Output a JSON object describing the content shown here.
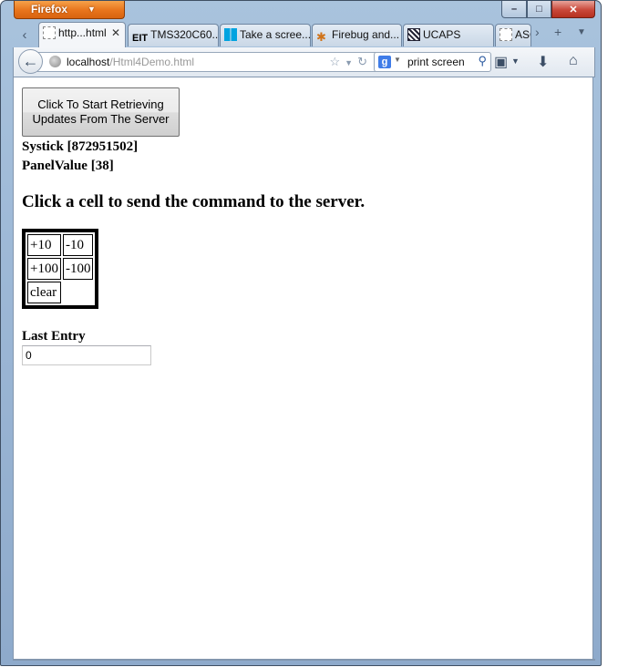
{
  "browser": {
    "menu_button": "Firefox",
    "caption": {
      "minimize": "–",
      "maximize": "□",
      "close": "✕"
    }
  },
  "tabs": [
    {
      "label": "http...html",
      "active": true,
      "icon": "blank-page-icon"
    },
    {
      "label": "TMS320C60...",
      "icon": "eit-icon",
      "icon_text": "EIT"
    },
    {
      "label": "Take a scree...",
      "icon": "windows-icon"
    },
    {
      "label": "Firebug and...",
      "icon": "firebug-icon"
    },
    {
      "label": "UCAPS",
      "icon": "ucaps-icon"
    },
    {
      "label": "ASC",
      "icon": "blank-page-icon"
    }
  ],
  "navbar": {
    "url_host": "localhost",
    "url_path": "/Html4Demo.html",
    "search_value": "print screen"
  },
  "page": {
    "start_button": "Click To Start Retrieving Updates From The Server",
    "systick": "Systick [872951502]",
    "panelvalue": "PanelValue [38]",
    "heading": "Click a cell to send the command to the server.",
    "commands": {
      "plus10": "+10",
      "minus10": "-10",
      "plus100": "+100",
      "minus100": "-100",
      "clear": "clear"
    },
    "last_entry_label": "Last Entry",
    "last_entry_value": "0"
  }
}
